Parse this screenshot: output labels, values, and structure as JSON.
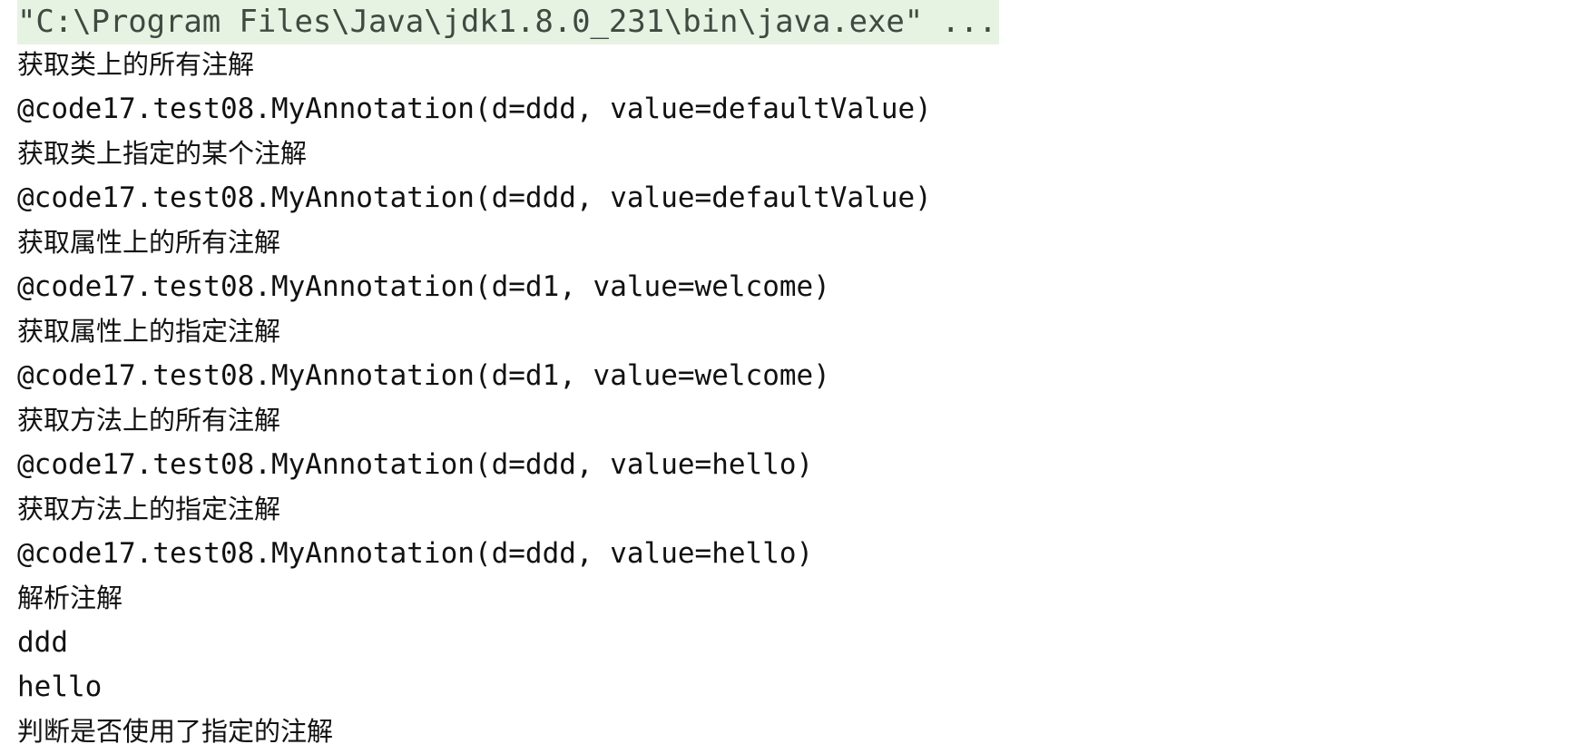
{
  "console": {
    "command": "\"C:\\Program Files\\Java\\jdk1.8.0_231\\bin\\java.exe\" ...",
    "lines": [
      {
        "text": "获取类上的所有注解",
        "kind": "cjk"
      },
      {
        "text": "@code17.test08.MyAnnotation(d=ddd, value=defaultValue)",
        "kind": "mono"
      },
      {
        "text": "获取类上指定的某个注解",
        "kind": "cjk"
      },
      {
        "text": "@code17.test08.MyAnnotation(d=ddd, value=defaultValue)",
        "kind": "mono"
      },
      {
        "text": "获取属性上的所有注解",
        "kind": "cjk"
      },
      {
        "text": "@code17.test08.MyAnnotation(d=d1, value=welcome)",
        "kind": "mono"
      },
      {
        "text": "获取属性上的指定注解",
        "kind": "cjk"
      },
      {
        "text": "@code17.test08.MyAnnotation(d=d1, value=welcome)",
        "kind": "mono"
      },
      {
        "text": "获取方法上的所有注解",
        "kind": "cjk"
      },
      {
        "text": "@code17.test08.MyAnnotation(d=ddd, value=hello)",
        "kind": "mono"
      },
      {
        "text": "获取方法上的指定注解",
        "kind": "cjk"
      },
      {
        "text": "@code17.test08.MyAnnotation(d=ddd, value=hello)",
        "kind": "mono"
      },
      {
        "text": "解析注解",
        "kind": "cjk"
      },
      {
        "text": "ddd",
        "kind": "mono"
      },
      {
        "text": "hello",
        "kind": "mono"
      },
      {
        "text": "判断是否使用了指定的注解",
        "kind": "cjk"
      }
    ]
  },
  "colors": {
    "command_background": "#e6f3e3",
    "text": "#111111"
  }
}
